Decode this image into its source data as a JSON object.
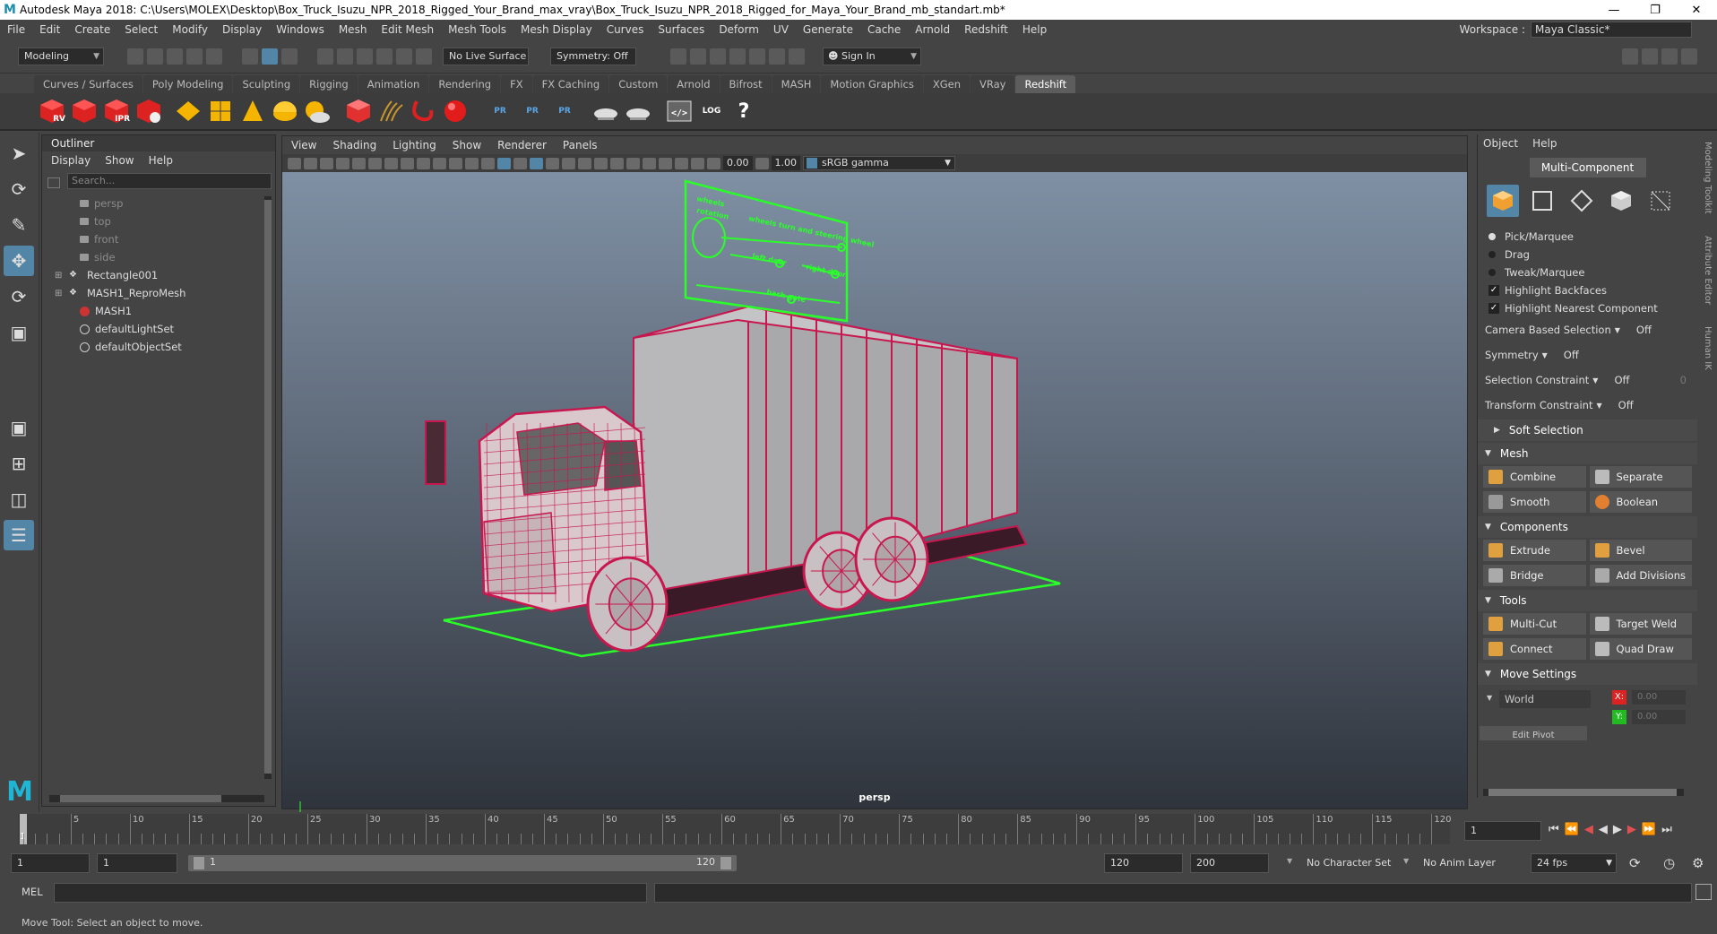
{
  "window": {
    "title": "Autodesk Maya 2018: C:\\Users\\MOLEX\\Desktop\\Box_Truck_Isuzu_NPR_2018_Rigged_Your_Brand_max_vray\\Box_Truck_Isuzu_NPR_2018_Rigged_for_Maya_Your_Brand_mb_standart.mb*",
    "logo": "M"
  },
  "menubar": {
    "items": [
      "File",
      "Edit",
      "Create",
      "Select",
      "Modify",
      "Display",
      "Windows",
      "Mesh",
      "Edit Mesh",
      "Mesh Tools",
      "Mesh Display",
      "Curves",
      "Surfaces",
      "Deform",
      "UV",
      "Generate",
      "Cache",
      "Arnold",
      "Redshift",
      "Help"
    ],
    "workspace_label": "Workspace :",
    "workspace_value": "Maya Classic*"
  },
  "statusline": {
    "mode": "Modeling",
    "live_surface": "No Live Surface",
    "symmetry": "Symmetry: Off",
    "sign_in": "Sign In"
  },
  "shelf": {
    "tabs": [
      "Curves / Surfaces",
      "Poly Modeling",
      "Sculpting",
      "Rigging",
      "Animation",
      "Rendering",
      "FX",
      "FX Caching",
      "Custom",
      "Arnold",
      "Bifrost",
      "MASH",
      "Motion Graphics",
      "XGen",
      "VRay",
      "Redshift"
    ],
    "active_tab": "Redshift",
    "icon_labels": [
      "RV",
      "IPR",
      "PR",
      "PR",
      "PR",
      "LOG",
      "?"
    ]
  },
  "outliner": {
    "title": "Outliner",
    "menu": [
      "Display",
      "Show",
      "Help"
    ],
    "search_placeholder": "Search...",
    "items": [
      {
        "label": "persp",
        "kind": "camera"
      },
      {
        "label": "top",
        "kind": "camera"
      },
      {
        "label": "front",
        "kind": "camera"
      },
      {
        "label": "side",
        "kind": "camera"
      },
      {
        "label": "Rectangle001",
        "kind": "group"
      },
      {
        "label": "MASH1_ReproMesh",
        "kind": "group"
      },
      {
        "label": "MASH1",
        "kind": "mash"
      },
      {
        "label": "defaultLightSet",
        "kind": "set"
      },
      {
        "label": "defaultObjectSet",
        "kind": "set"
      }
    ]
  },
  "viewport": {
    "menu": [
      "View",
      "Shading",
      "Lighting",
      "Show",
      "Renderer",
      "Panels"
    ],
    "exposure": "0.00",
    "gamma": "1.00",
    "color_space": "sRGB gamma",
    "camera": "persp",
    "mesh_color": "#c8174f",
    "control_color": "#2aff2a",
    "control_panel_texts": [
      "wheels",
      "rotation",
      "wheels turn and steering wheel",
      "left door",
      "right door",
      "back gate"
    ]
  },
  "modeling_toolkit": {
    "menu": [
      "Object",
      "Help"
    ],
    "multi_component": "Multi-Component",
    "pick_options": [
      "Pick/Marquee",
      "Drag",
      "Tweak/Marquee"
    ],
    "checks": [
      "Highlight Backfaces",
      "Highlight Nearest Component"
    ],
    "camera_based_selection": {
      "label": "Camera Based Selection",
      "value": "Off"
    },
    "symmetry": {
      "label": "Symmetry",
      "value": "Off"
    },
    "selection_constraint": {
      "label": "Selection Constraint",
      "value": "Off",
      "extra": "0"
    },
    "transform_constraint": {
      "label": "Transform Constraint",
      "value": "Off"
    },
    "soft_selection": "Soft Selection",
    "mesh": {
      "title": "Mesh",
      "buttons": [
        "Combine",
        "Separate",
        "Smooth",
        "Boolean"
      ]
    },
    "components": {
      "title": "Components",
      "buttons": [
        "Extrude",
        "Bevel",
        "Bridge",
        "Add Divisions"
      ]
    },
    "tools": {
      "title": "Tools",
      "buttons": [
        "Multi-Cut",
        "Target Weld",
        "Connect",
        "Quad Draw"
      ]
    },
    "move_settings": {
      "title": "Move Settings",
      "space": "World",
      "x": "0.00",
      "y": "0.00",
      "edit_pivot": "Edit Pivot"
    }
  },
  "sidetabs": [
    "Modeling Toolkit",
    "Attribute Editor",
    "Human IK"
  ],
  "timeline": {
    "ticks": [
      "5",
      "10",
      "15",
      "20",
      "25",
      "30",
      "35",
      "40",
      "45",
      "50",
      "55",
      "60",
      "65",
      "70",
      "75",
      "80",
      "85",
      "90",
      "95",
      "100",
      "105",
      "110",
      "115",
      "120"
    ],
    "current_frame_marker": "1",
    "current_frame": "1",
    "range_start": "1",
    "playback_start": "1",
    "slider_start": "1",
    "slider_end": "120",
    "playback_end": "120",
    "range_end": "200",
    "character_set": "No Character Set",
    "anim_layer": "No Anim Layer",
    "fps": "24 fps"
  },
  "cmdline": {
    "label": "MEL"
  },
  "helpline": {
    "text": "Move Tool: Select an object to move."
  }
}
